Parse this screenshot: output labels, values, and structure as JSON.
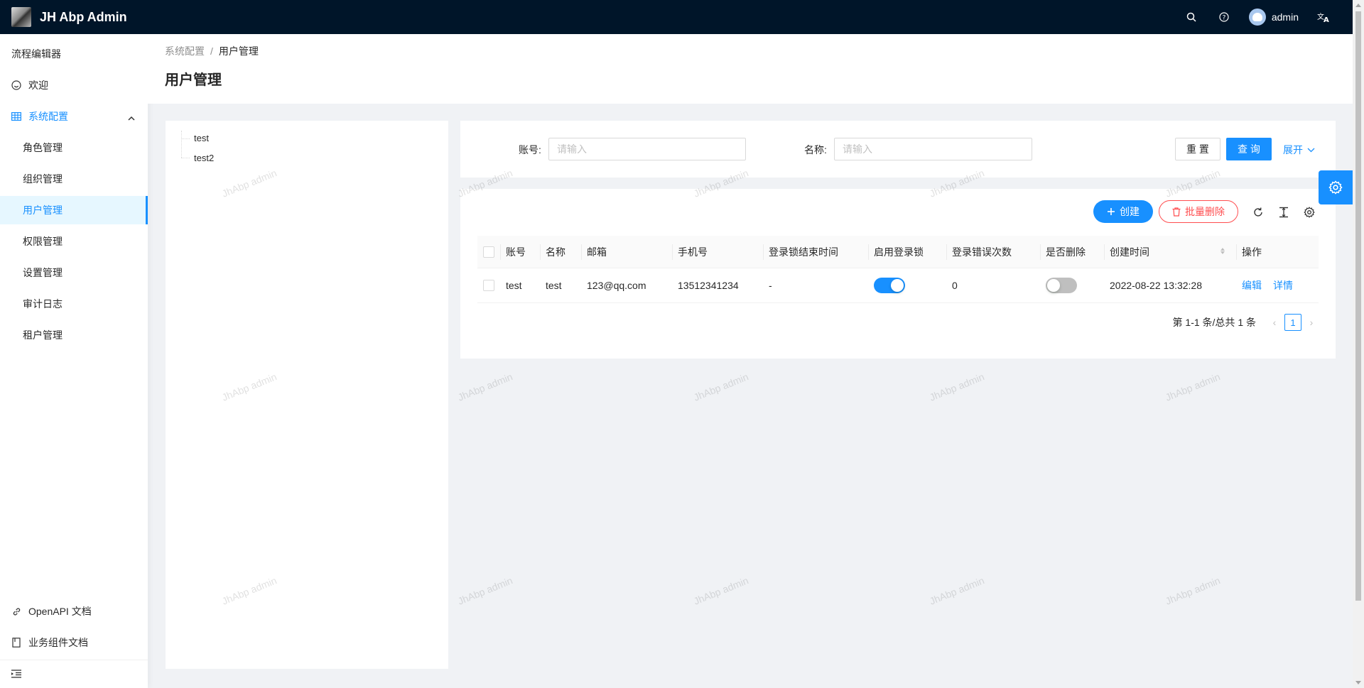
{
  "app": {
    "title": "JH Abp Admin",
    "user_name": "admin",
    "accent_color": "#1890ff",
    "header_bg": "#001529"
  },
  "header_icons": [
    "search-icon",
    "question-icon",
    "translate-icon"
  ],
  "sidebar": {
    "items": [
      {
        "label": "流程编辑器",
        "icon": "",
        "level": 0
      },
      {
        "label": "欢迎",
        "icon": "smile-icon",
        "level": 0
      },
      {
        "label": "系统配置",
        "icon": "table-icon",
        "level": 0,
        "open": true
      },
      {
        "label": "角色管理",
        "level": 1
      },
      {
        "label": "组织管理",
        "level": 1
      },
      {
        "label": "用户管理",
        "level": 1,
        "active": true
      },
      {
        "label": "权限管理",
        "level": 1
      },
      {
        "label": "设置管理",
        "level": 1
      },
      {
        "label": "审计日志",
        "level": 1
      },
      {
        "label": "租户管理",
        "level": 1
      }
    ],
    "bottom_items": [
      {
        "label": "OpenAPI 文档",
        "icon": "link-icon"
      },
      {
        "label": "业务组件文档",
        "icon": "book-icon"
      }
    ]
  },
  "breadcrumb": {
    "items": [
      "系统配置",
      "用户管理"
    ],
    "separator": "/"
  },
  "page_title": "用户管理",
  "tree": {
    "nodes": [
      "test",
      "test2"
    ]
  },
  "search": {
    "account_label": "账号:",
    "account_placeholder": "请输入",
    "name_label": "名称:",
    "name_placeholder": "请输入",
    "reset_label": "重 置",
    "query_label": "查 询",
    "expand_label": "展开"
  },
  "toolbar": {
    "create_label": "创建",
    "batch_delete_label": "批量删除"
  },
  "table": {
    "columns": [
      "账号",
      "名称",
      "邮箱",
      "手机号",
      "登录锁结束时间",
      "启用登录锁",
      "登录错误次数",
      "是否删除",
      "创建时间",
      "操作"
    ],
    "rows": [
      {
        "account": "test",
        "name": "test",
        "email": "123@qq.com",
        "phone": "13512341234",
        "lock_end": "-",
        "lock_enabled": true,
        "error_count": "0",
        "deleted": false,
        "created": "2022-08-22 13:32:28",
        "edit_label": "编辑",
        "detail_label": "详情"
      }
    ]
  },
  "pagination": {
    "total_text": "第 1-1 条/总共 1 条",
    "current_page": "1"
  },
  "watermark_text": "JhAbp admin"
}
